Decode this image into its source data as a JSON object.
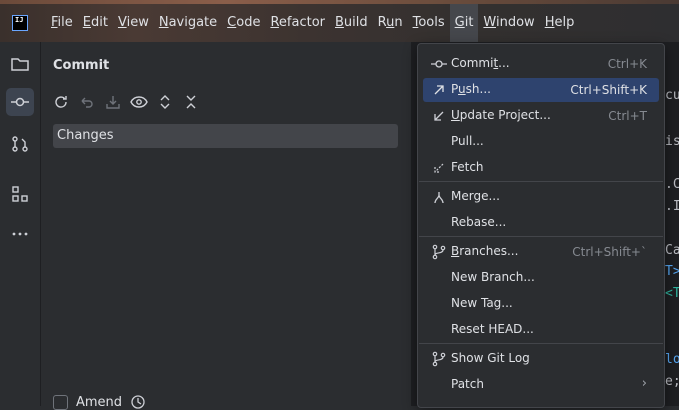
{
  "menubar": {
    "logo_text": "IJ",
    "items": [
      {
        "label": "File",
        "mnemonic": "F",
        "rest": "ile"
      },
      {
        "label": "Edit",
        "mnemonic": "E",
        "rest": "dit"
      },
      {
        "label": "View",
        "mnemonic": "V",
        "rest": "iew"
      },
      {
        "label": "Navigate",
        "mnemonic": "N",
        "rest": "avigate"
      },
      {
        "label": "Code",
        "mnemonic": "C",
        "rest": "ode"
      },
      {
        "label": "Refactor",
        "mnemonic": "R",
        "rest": "efactor"
      },
      {
        "label": "Build",
        "mnemonic": "B",
        "rest": "uild"
      },
      {
        "label": "Run",
        "mnemonic": "R",
        "rest": "un",
        "mn_index": 1
      },
      {
        "label": "Tools",
        "mnemonic": "T",
        "rest": "ools"
      },
      {
        "label": "Git",
        "mnemonic": "G",
        "rest": "it"
      },
      {
        "label": "Window",
        "mnemonic": "W",
        "rest": "indow"
      },
      {
        "label": "Help",
        "mnemonic": "H",
        "rest": "elp"
      }
    ]
  },
  "commit_panel": {
    "title": "Commit",
    "changes_label": "Changes",
    "amend_label": "Amend"
  },
  "editor_fragments": [
    {
      "text": "cu",
      "color": "#bcbec4"
    },
    {
      "text": "is",
      "color": "#bcbec4"
    },
    {
      "text": ".C",
      "color": "#bcbec4"
    },
    {
      "text": ".I",
      "color": "#bcbec4"
    },
    {
      "text": "Ca",
      "color": "#bcbec4"
    },
    {
      "text": "T>",
      "color": "#56a8f5"
    },
    {
      "text": "<T",
      "color": "#2fb5a0"
    },
    {
      "text": "lo",
      "color": "#56a8f5"
    },
    {
      "text": "e;",
      "color": "#bcbec4"
    }
  ],
  "git_menu": {
    "items": [
      {
        "id": "commit",
        "pre": "Commi",
        "u": "t",
        "post": "...",
        "shortcut": "Ctrl+K",
        "icon": "commit-icon"
      },
      {
        "id": "push",
        "pre": "P",
        "u": "u",
        "post": "sh...",
        "shortcut": "Ctrl+Shift+K",
        "icon": "push-arrow-icon",
        "highlighted": true
      },
      {
        "id": "update-project",
        "pre": "",
        "u": "U",
        "post": "pdate Project...",
        "shortcut": "Ctrl+T",
        "icon": "update-arrow-icon"
      },
      {
        "id": "pull",
        "pre": "Pull...",
        "u": "",
        "post": "",
        "shortcut": "",
        "icon": ""
      },
      {
        "id": "fetch",
        "pre": "Fetch",
        "u": "",
        "post": "",
        "shortcut": "",
        "icon": "fetch-icon"
      },
      {
        "id": "merge",
        "pre": "Merge...",
        "u": "",
        "post": "",
        "shortcut": "",
        "icon": "merge-icon"
      },
      {
        "id": "rebase",
        "pre": "Rebase...",
        "u": "",
        "post": "",
        "shortcut": "",
        "icon": ""
      },
      {
        "id": "branches",
        "pre": "",
        "u": "B",
        "post": "ranches...",
        "shortcut": "Ctrl+Shift+`",
        "icon": "branch-icon"
      },
      {
        "id": "new-branch",
        "pre": "New Branch...",
        "u": "",
        "post": "",
        "shortcut": "",
        "icon": ""
      },
      {
        "id": "new-tag",
        "pre": "New Tag...",
        "u": "",
        "post": "",
        "shortcut": "",
        "icon": ""
      },
      {
        "id": "reset-head",
        "pre": "Reset HEAD...",
        "u": "",
        "post": "",
        "shortcut": "",
        "icon": ""
      },
      {
        "id": "show-git-log",
        "pre": "Show Git Log",
        "u": "",
        "post": "",
        "shortcut": "",
        "icon": "git-log-icon"
      },
      {
        "id": "patch",
        "pre": "Patch",
        "u": "",
        "post": "",
        "shortcut": "",
        "icon": "",
        "submenu": "›"
      }
    ]
  }
}
